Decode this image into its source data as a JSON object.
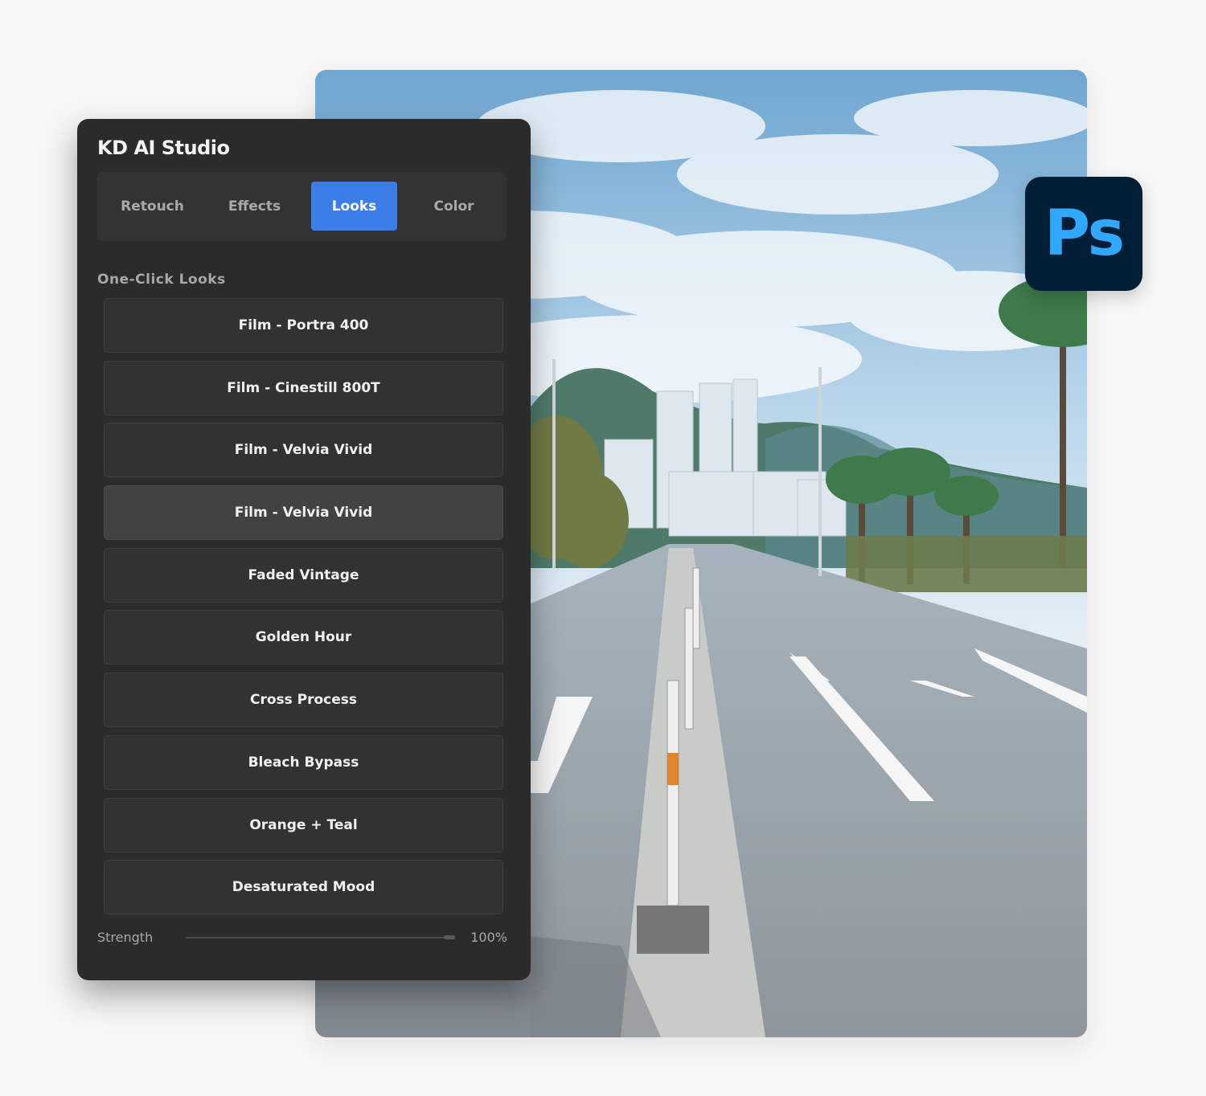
{
  "panel": {
    "title": "KD AI Studio",
    "tabs": [
      {
        "label": "Retouch",
        "active": false
      },
      {
        "label": "Effects",
        "active": false
      },
      {
        "label": "Looks",
        "active": true
      },
      {
        "label": "Color",
        "active": false
      }
    ],
    "section_label": "One-Click Looks",
    "looks": [
      {
        "label": "Film - Portra 400",
        "highlighted": false
      },
      {
        "label": "Film - Cinestill 800T",
        "highlighted": false
      },
      {
        "label": "Film - Velvia Vivid",
        "highlighted": false
      },
      {
        "label": "Film - Velvia Vivid",
        "highlighted": true
      },
      {
        "label": "Faded Vintage",
        "highlighted": false
      },
      {
        "label": "Golden Hour",
        "highlighted": false
      },
      {
        "label": "Cross Process",
        "highlighted": false
      },
      {
        "label": "Bleach Bypass",
        "highlighted": false
      },
      {
        "label": "Orange + Teal",
        "highlighted": false
      },
      {
        "label": "Desaturated Mood",
        "highlighted": false
      }
    ],
    "strength": {
      "label": "Strength",
      "value_text": "100%",
      "value": 1.0
    }
  },
  "badge": {
    "text": "Ps",
    "icon": "photoshop-icon"
  },
  "colors": {
    "panel_bg": "#2b2b2b",
    "accent": "#3b7ee8",
    "badge_bg": "#001e36",
    "badge_text": "#31a8ff"
  }
}
